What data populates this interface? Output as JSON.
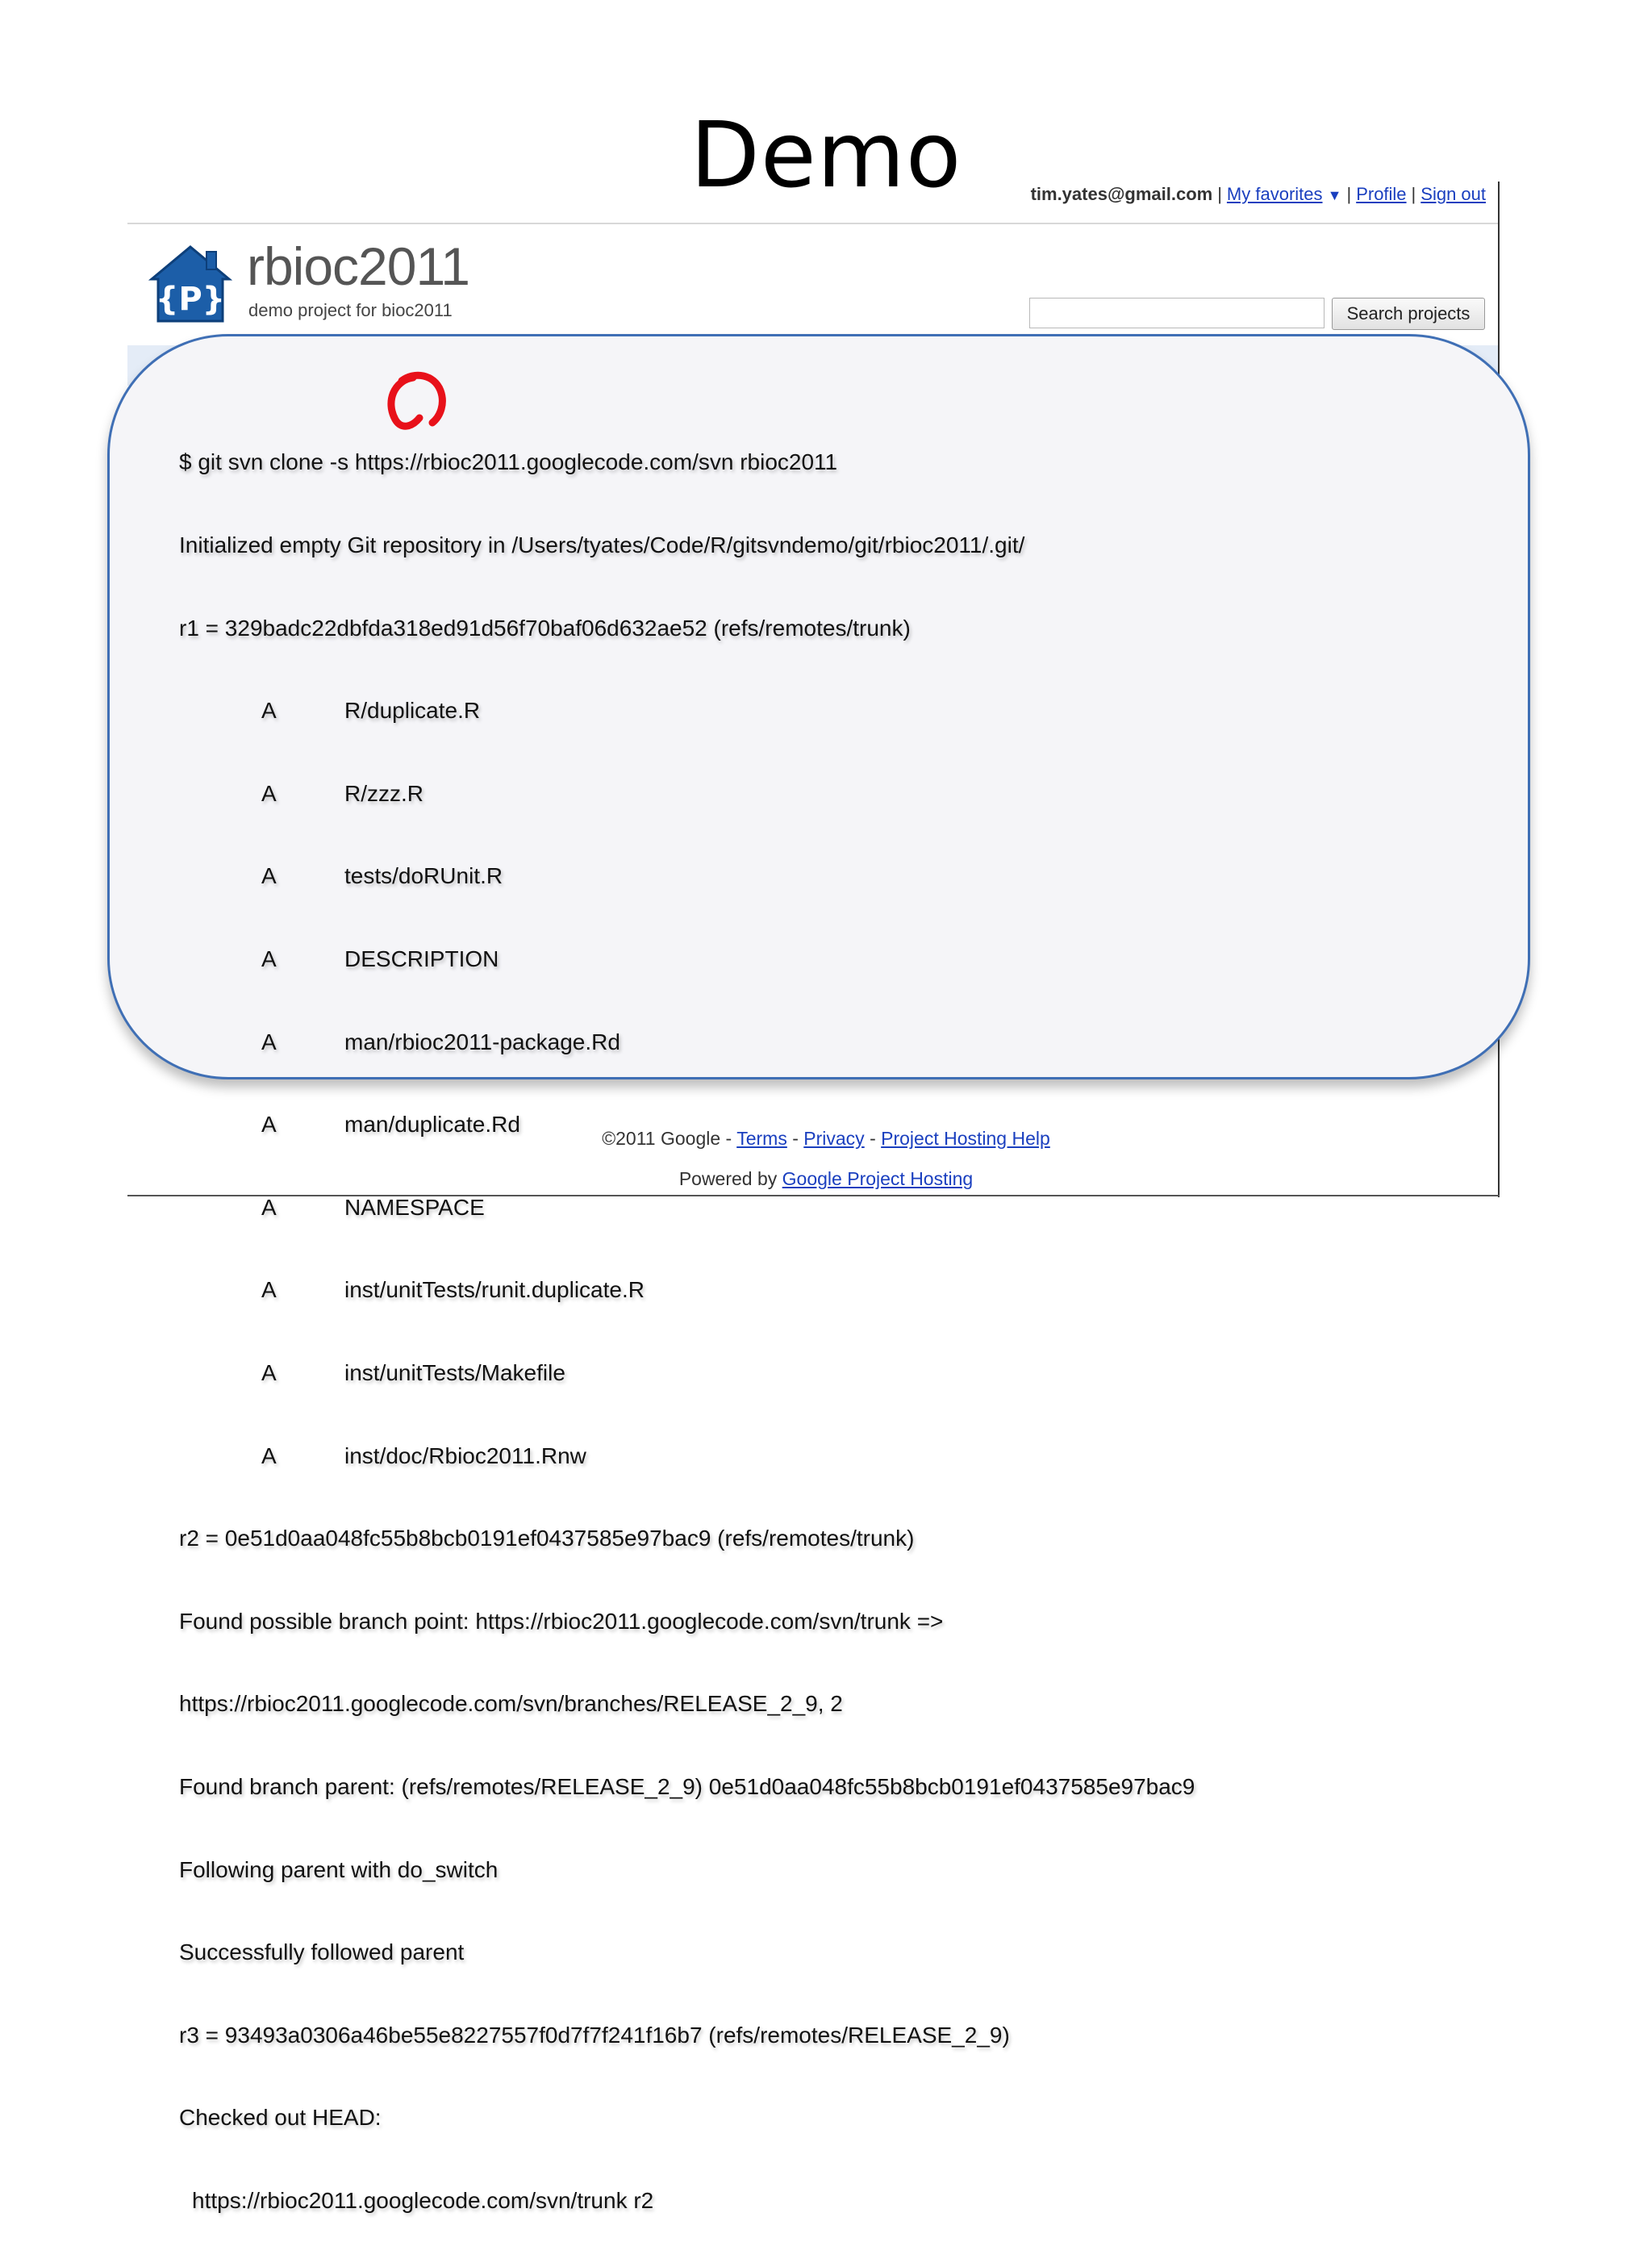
{
  "slide": {
    "title": "Demo"
  },
  "account": {
    "email": "tim.yates@gmail.com",
    "favorites_label": "My favorites",
    "favorites_caret": "▼",
    "profile_label": "Profile",
    "signout_label": "Sign out",
    "separator": "|"
  },
  "project": {
    "logo_glyph": "{P}",
    "name": "rbioc2011",
    "summary": "demo project for bioc2011"
  },
  "search": {
    "input_value": "",
    "button_label": "Search projects"
  },
  "terminal": {
    "lines_before": [
      "$ git svn clone -s https://rbioc2011.googlecode.com/svn rbioc2011",
      "Initialized empty Git repository in /Users/tyates/Code/R/gitsvndemo/git/rbioc2011/.git/",
      "r1 = 329badc22dbfda318ed91d56f70baf06d632ae52 (refs/remotes/trunk)"
    ],
    "files": [
      {
        "status": "A",
        "path": "R/duplicate.R"
      },
      {
        "status": "A",
        "path": "R/zzz.R"
      },
      {
        "status": "A",
        "path": "tests/doRUnit.R"
      },
      {
        "status": "A",
        "path": "DESCRIPTION"
      },
      {
        "status": "A",
        "path": "man/rbioc2011-package.Rd"
      },
      {
        "status": "A",
        "path": "man/duplicate.Rd"
      },
      {
        "status": "A",
        "path": "NAMESPACE"
      },
      {
        "status": "A",
        "path": "inst/unitTests/runit.duplicate.R"
      },
      {
        "status": "A",
        "path": "inst/unitTests/Makefile"
      },
      {
        "status": "A",
        "path": "inst/doc/Rbioc2011.Rnw"
      }
    ],
    "lines_after": [
      "r2 = 0e51d0aa048fc55b8bcb0191ef0437585e97bac9 (refs/remotes/trunk)",
      "Found possible branch point: https://rbioc2011.googlecode.com/svn/trunk =>",
      "https://rbioc2011.googlecode.com/svn/branches/RELEASE_2_9, 2",
      "Found branch parent: (refs/remotes/RELEASE_2_9) 0e51d0aa048fc55b8bcb0191ef0437585e97bac9",
      "Following parent with do_switch",
      "Successfully followed parent",
      "r3 = 93493a0306a46be55e8227557f0d7f7f241f16b7 (refs/remotes/RELEASE_2_9)",
      "Checked out HEAD:"
    ],
    "last_line": "https://rbioc2011.googlecode.com/svn/trunk r2"
  },
  "footer": {
    "copyright": "©2011 Google",
    "dash": "-",
    "terms_label": "Terms",
    "privacy_label": "Privacy",
    "help_label": "Project Hosting Help",
    "powered_by_label": "Powered by",
    "powered_by_link": "Google Project Hosting"
  },
  "colors": {
    "link": "#1a3fbf",
    "overlay_border": "#3f6fb5",
    "overlay_fill": "#f5f5f8",
    "logo_blue": "#1c5ea8",
    "annotation_red": "#e8111a"
  },
  "icons": {
    "logo": "project-hosting-house-icon",
    "annotation": "red-circle-annotation"
  }
}
